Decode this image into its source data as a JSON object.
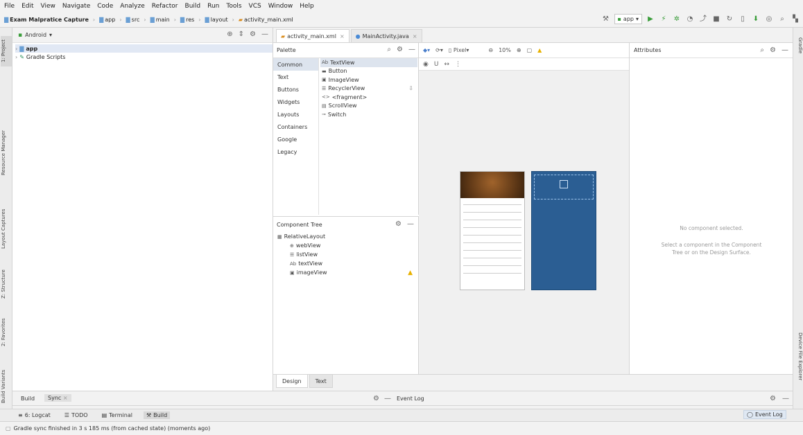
{
  "menu": [
    "File",
    "Edit",
    "View",
    "Navigate",
    "Code",
    "Analyze",
    "Refactor",
    "Build",
    "Run",
    "Tools",
    "VCS",
    "Window",
    "Help"
  ],
  "breadcrumbs": [
    "Exam Malpratice Capture",
    "app",
    "src",
    "main",
    "res",
    "layout",
    "activity_main.xml"
  ],
  "run_config": "app",
  "left_tabs": {
    "project": "1: Project",
    "resource": "Resource Manager",
    "layout": "Layout Captures",
    "structure": "Z: Structure",
    "favorites": "2: Favorites",
    "variants": "Build Variants"
  },
  "right_tabs": {
    "gradle": "Gradle",
    "device": "Device File Explorer"
  },
  "project_panel": {
    "view_mode": "Android",
    "tree": [
      "app",
      "Gradle Scripts"
    ]
  },
  "editor_tabs": [
    {
      "label": "activity_main.xml",
      "active": true
    },
    {
      "label": "MainActivity.java",
      "active": false
    }
  ],
  "palette": {
    "title": "Palette",
    "categories": [
      "Common",
      "Text",
      "Buttons",
      "Widgets",
      "Layouts",
      "Containers",
      "Google",
      "Legacy"
    ],
    "widgets": [
      {
        "icon": "Ab",
        "label": "TextView"
      },
      {
        "icon": "▬",
        "label": "Button"
      },
      {
        "icon": "▣",
        "label": "ImageView"
      },
      {
        "icon": "☰",
        "label": "RecyclerView"
      },
      {
        "icon": "<>",
        "label": "<fragment>"
      },
      {
        "icon": "▤",
        "label": "ScrollView"
      },
      {
        "icon": "⊸",
        "label": "Switch"
      }
    ]
  },
  "component_tree": {
    "title": "Component Tree",
    "items": [
      {
        "icon": "▦",
        "label": "RelativeLayout",
        "indent": 0,
        "warn": false
      },
      {
        "icon": "⊕",
        "label": "webView",
        "indent": 1,
        "warn": false
      },
      {
        "icon": "☰",
        "label": "listView",
        "indent": 1,
        "warn": false
      },
      {
        "icon": "Ab",
        "label": "textView",
        "indent": 1,
        "warn": false
      },
      {
        "icon": "▣",
        "label": "imageView",
        "indent": 1,
        "warn": true
      }
    ]
  },
  "design_toolbar": {
    "device": "Pixel",
    "zoom": "10%"
  },
  "attributes": {
    "title": "Attributes",
    "msg1": "No component selected.",
    "msg2a": "Select a component in the Component",
    "msg2b": "Tree or on the Design Surface."
  },
  "design_tabs": [
    "Design",
    "Text"
  ],
  "bottom_panel": {
    "build": "Build",
    "sync": "Sync",
    "event_log": "Event Log"
  },
  "bottom_toolbar": [
    {
      "label": "6: Logcat",
      "active": false
    },
    {
      "label": "TODO",
      "active": false
    },
    {
      "label": "Terminal",
      "active": false
    },
    {
      "label": "Build",
      "active": true
    }
  ],
  "event_log_btn": "Event Log",
  "status": "Gradle sync finished in 3 s 185 ms (from cached state) (moments ago)",
  "colors": {
    "blueprint": "#2b5e93",
    "accent": "#3a9d3a"
  }
}
